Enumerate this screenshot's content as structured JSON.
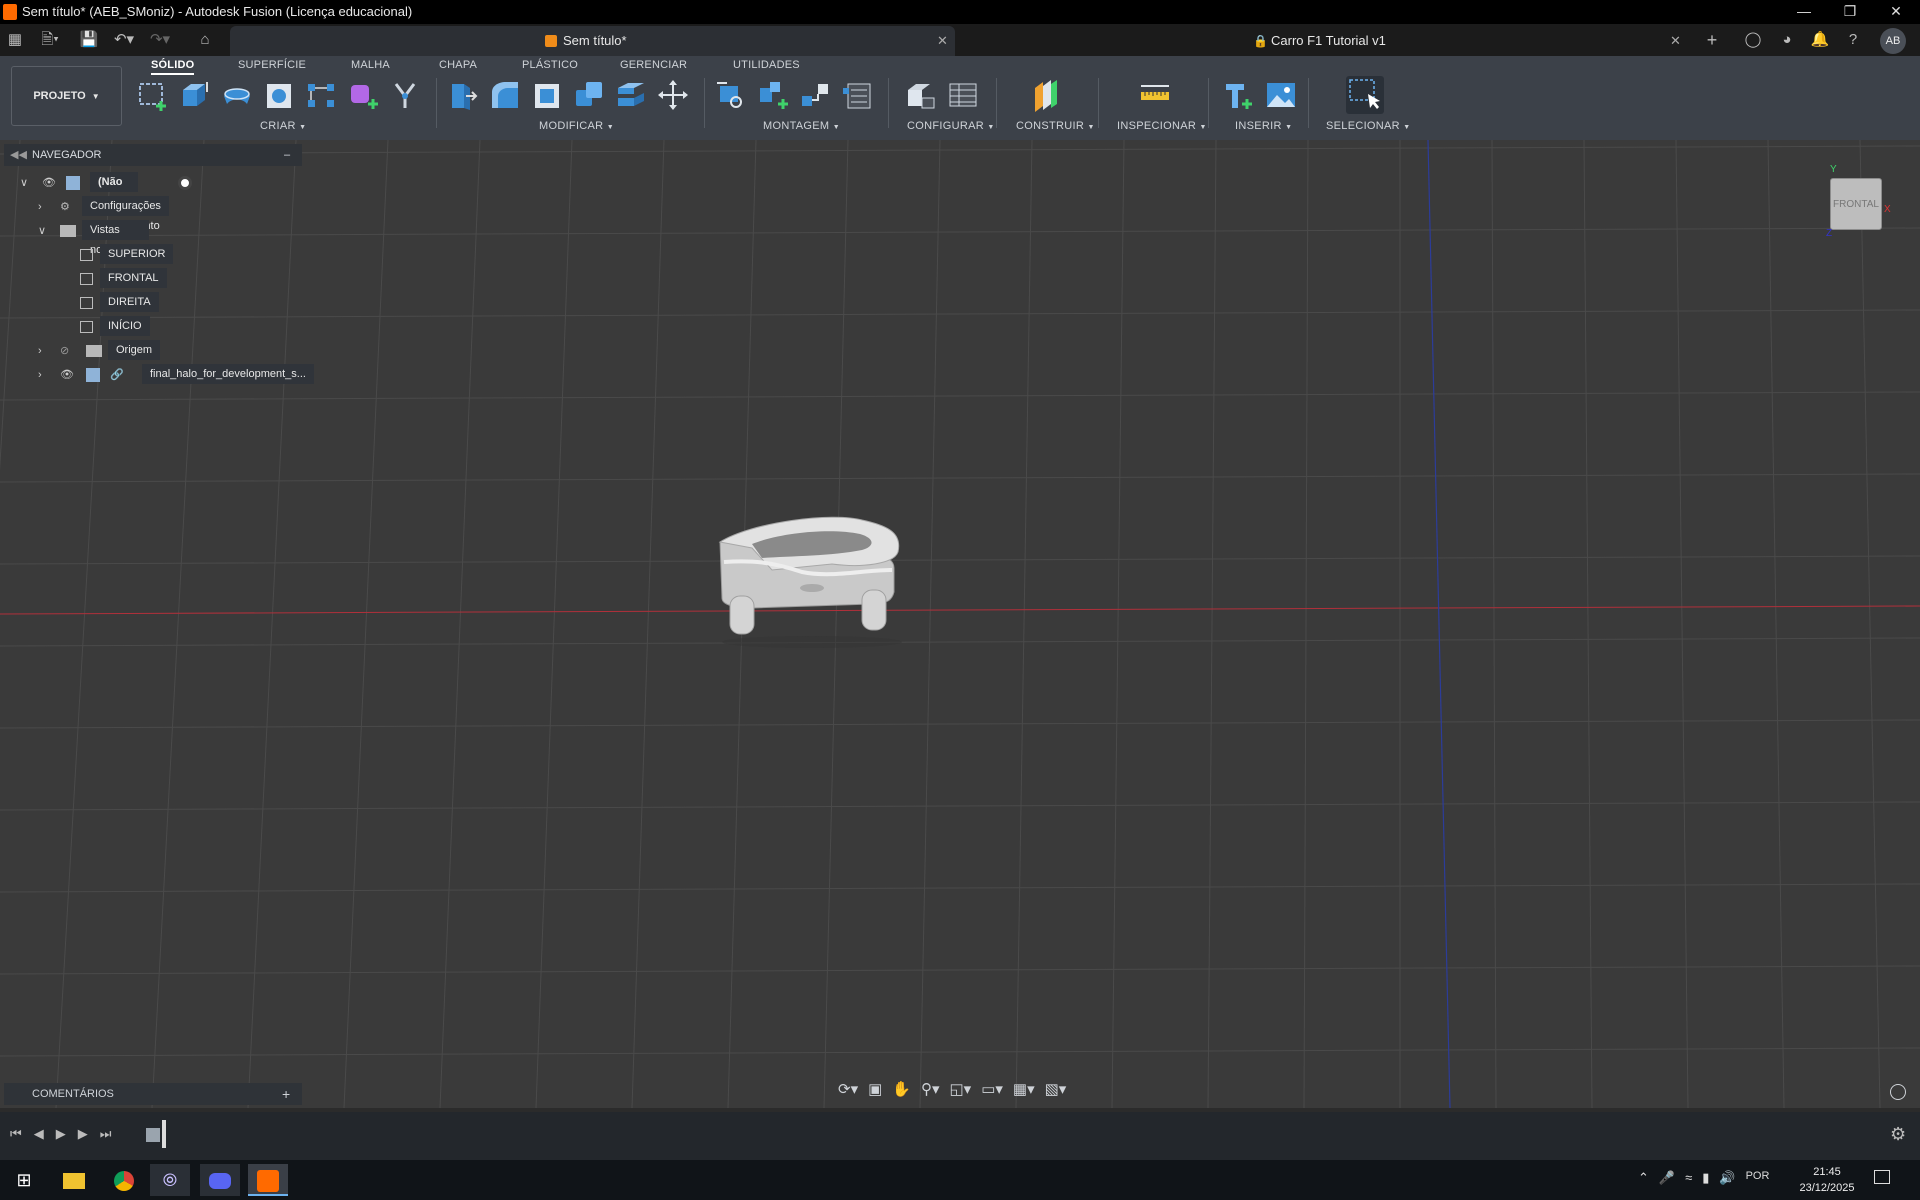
{
  "app": {
    "window_title": "Sem título* (AEB_SMoniz) - Autodesk Fusion (Licença educacional)"
  },
  "tabs": [
    {
      "label": "Sem título*",
      "active": true
    },
    {
      "label": "Carro F1 Tutorial v1",
      "active": false
    }
  ],
  "header": {
    "user_initials": "AB"
  },
  "ribbon": {
    "tabs": [
      "SÓLIDO",
      "SUPERFÍCIE",
      "MALHA",
      "CHAPA",
      "PLÁSTICO",
      "GERENCIAR",
      "UTILIDADES"
    ],
    "active_tab": "SÓLIDO",
    "project_button": "PROJETO",
    "groups": [
      "CRIAR",
      "MODIFICAR",
      "MONTAGEM",
      "CONFIGURAR",
      "CONSTRUIR",
      "INSPECIONAR",
      "INSERIR",
      "SELECIONAR"
    ]
  },
  "navigator": {
    "title": "NAVEGADOR",
    "root": "(Não salvo)",
    "items": [
      {
        "label": "Configurações do documento"
      },
      {
        "label": "Vistas nomeadas"
      },
      {
        "label": "SUPERIOR"
      },
      {
        "label": "FRONTAL"
      },
      {
        "label": "DIREITA"
      },
      {
        "label": "INÍCIO"
      },
      {
        "label": "Origem"
      },
      {
        "label": "final_halo_for_development_s..."
      }
    ]
  },
  "viewcube": {
    "face_label": "FRONTAL",
    "axis_y": "Y",
    "axis_x": "X",
    "axis_z": "Z"
  },
  "comments": {
    "title": "COMENTÁRIOS"
  },
  "taskbar": {
    "language": "POR",
    "time": "21:45",
    "date": "23/12/2025"
  },
  "colors": {
    "accent": "#ff6a00",
    "ribbon_bg": "#3c4149",
    "viewport_bg": "#3a3a3a"
  }
}
